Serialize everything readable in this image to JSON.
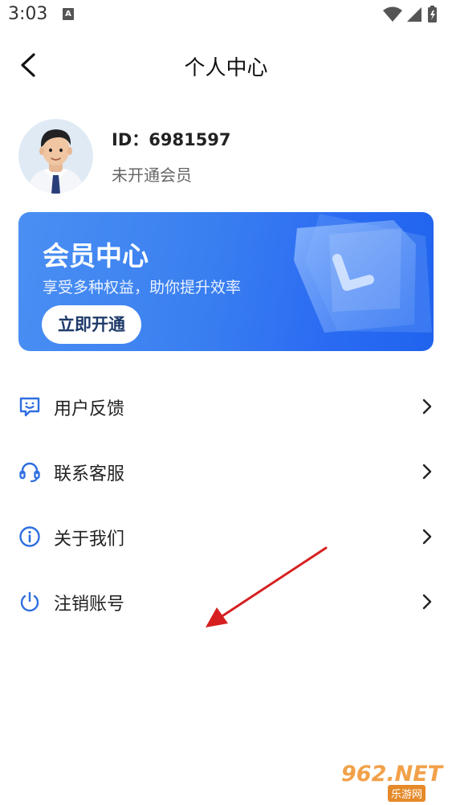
{
  "status_bar": {
    "time": "3:03",
    "notification_letter": "A",
    "icons": [
      "wifi-icon",
      "signal-icon",
      "battery-icon"
    ]
  },
  "nav": {
    "title": "个人中心",
    "back_icon": "chevron-left-icon"
  },
  "profile": {
    "user_id": "ID：6981597",
    "membership_status": "未开通会员",
    "avatar_icon": "avatar-man-in-suit"
  },
  "vip_card": {
    "title": "会员中心",
    "subtitle": "享受多种权益，助你提升效率",
    "button_label": "立即开通",
    "colors": {
      "start": "#4a8ff3",
      "end": "#1f63ee"
    }
  },
  "menu": {
    "items": [
      {
        "label": "用户反馈",
        "icon": "feedback-smile-icon"
      },
      {
        "label": "联系客服",
        "icon": "headset-icon"
      },
      {
        "label": "关于我们",
        "icon": "info-circle-icon"
      },
      {
        "label": "注销账号",
        "icon": "power-icon"
      }
    ],
    "icon_color": "#2f6fe0"
  },
  "watermark": {
    "top_text": "962.NET",
    "bottom_text": "乐游网"
  },
  "annotation": {
    "arrow_color": "#d62020"
  }
}
